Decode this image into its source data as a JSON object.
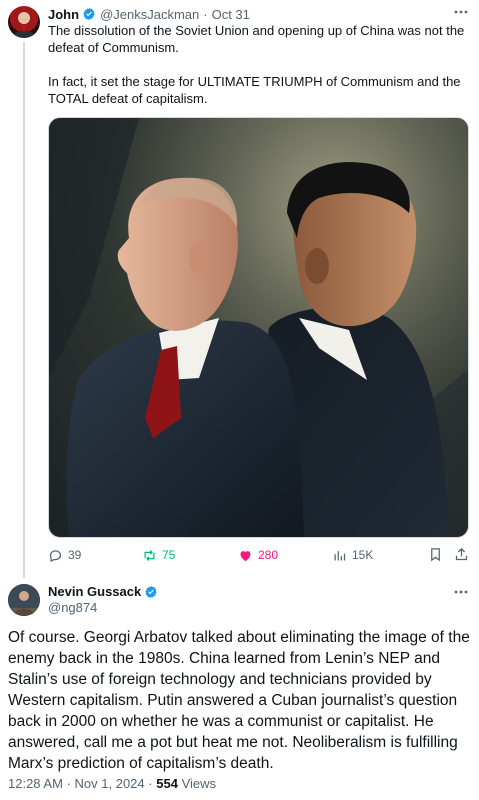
{
  "parent_tweet": {
    "author_name": "John",
    "author_handle": "@JenksJackman",
    "separator": "·",
    "date": "Oct 31",
    "paragraphs": [
      "The dissolution of the Soviet Union and opening up of China was not the defeat of Communism.",
      "In fact, it set the stage for ULTIMATE TRIUMPH of Communism and the TOTAL defeat of capitalism."
    ],
    "stats": {
      "replies": "39",
      "reposts": "75",
      "likes": "280",
      "views": "15K"
    },
    "colors": {
      "repost": "#00ba7c",
      "like": "#f91880",
      "muted": "#536471",
      "verified": "#1d9bf0"
    }
  },
  "reply_tweet": {
    "author_name": "Nevin Gussack",
    "author_handle": "@ng874",
    "text": "Of course. Georgi Arbatov talked about eliminating the image of the enemy back in the 1980s. China learned from Lenin’s NEP and Stalin’s use of foreign technology and technicians provided by Western capitalism. Putin answered a Cuban journalist’s question back in 2000 on whether he was a communist or capitalist. He answered, call me a pot but heat me not. Neoliberalism is fulfilling Marx’s prediction of capitalism’s death.",
    "time": "12:28 AM",
    "date": "Nov 1, 2024",
    "separator": "·",
    "views_count": "554",
    "views_label": "Views"
  },
  "icons": [
    "verified-badge-icon",
    "more-icon",
    "reply-icon",
    "repost-icon",
    "like-icon",
    "views-icon",
    "bookmark-icon",
    "share-icon"
  ]
}
